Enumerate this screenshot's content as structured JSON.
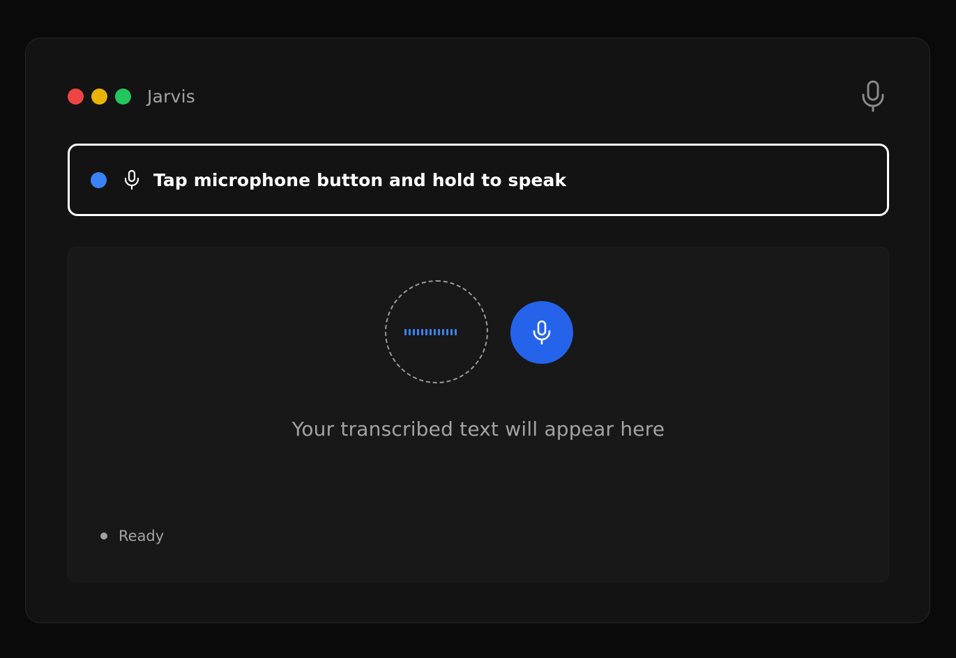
{
  "app": {
    "title": "Jarvis"
  },
  "window_controls": {
    "close_color": "#ef4444",
    "minimize_color": "#eab308",
    "maximize_color": "#22c55e"
  },
  "hint": {
    "text": "Tap microphone button and hold to speak",
    "dot_color": "#3b82f6"
  },
  "recorder": {
    "button_color": "#2563eb",
    "wave_color": "#3b82f6",
    "wave_bar_count": 13
  },
  "transcript": {
    "placeholder": "Your transcribed text will appear here"
  },
  "status": {
    "text": "Ready",
    "dot_color": "#a3a3a3"
  },
  "icons": {
    "top_mic": "microphone-icon",
    "hint_mic": "microphone-icon",
    "record_mic": "microphone-icon"
  }
}
